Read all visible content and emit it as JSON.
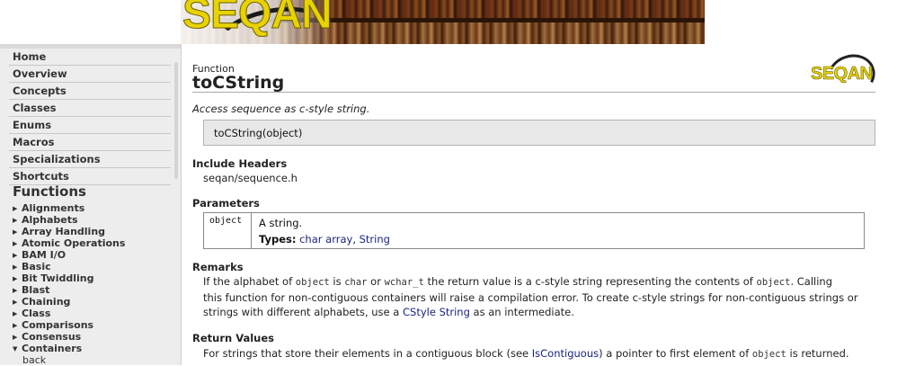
{
  "banner": {
    "logo_text": "SEQAN"
  },
  "sidebar": {
    "nav": [
      "Home",
      "Overview",
      "Concepts",
      "Classes",
      "Enums",
      "Macros",
      "Specializations",
      "Shortcuts"
    ],
    "functions_heading": "Functions",
    "functions": [
      "Alignments",
      "Alphabets",
      "Array Handling",
      "Atomic Operations",
      "BAM I/O",
      "Basic",
      "Bit Twiddling",
      "Blast",
      "Chaining",
      "Class",
      "Comparisons",
      "Consensus",
      "Containers"
    ],
    "expanded_item": "Containers",
    "sub_items": [
      "back"
    ]
  },
  "page": {
    "kind": "Function",
    "title": "toCString",
    "logo_text": "SEQAN",
    "summary": "Access sequence as c-style string.",
    "signature": "toCString(object)",
    "include_heading": "Include Headers",
    "include_value": "seqan/sequence.h",
    "params_heading": "Parameters",
    "param": {
      "name": "object",
      "description": "A string.",
      "types_label": "Types:",
      "type_1": "char array",
      "type_sep": ",",
      "type_2": "String"
    },
    "remarks_heading": "Remarks",
    "remarks": {
      "l1_a": "If the alphabet of ",
      "l1_code1": "object",
      "l1_b": " is ",
      "l1_code2": "char",
      "l1_c": " or ",
      "l1_code3": "wchar_t",
      "l1_d": " the return value is a c-style string representing the contents of ",
      "l1_code4": "object",
      "l1_e": ". Calling",
      "l2": "this function for non-contiguous containers will raise a compilation error. To create c-style strings for non-contiguous strings or",
      "l3_a": "strings with different alphabets, use a ",
      "l3_link": "CStyle String",
      "l3_b": " as an intermediate."
    },
    "returns_heading": "Return Values",
    "returns": {
      "a": "For strings that store their elements in a contiguous block (see ",
      "link": "IsContiguous",
      "b": ") a pointer to first element of ",
      "code": "object",
      "c": " is returned."
    }
  }
}
